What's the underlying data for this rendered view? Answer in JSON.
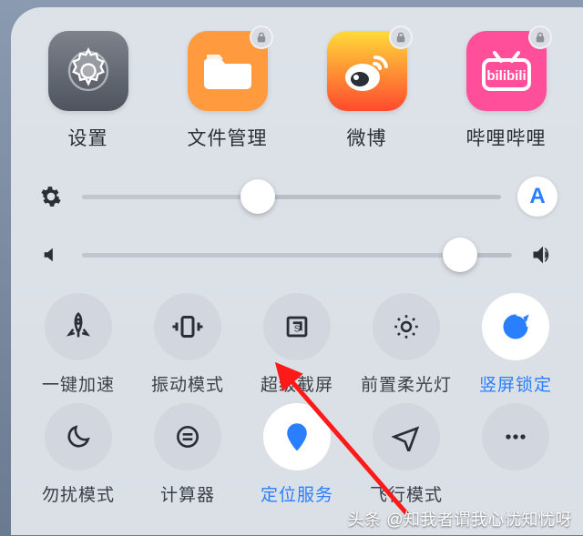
{
  "apps": [
    {
      "label": "设置",
      "locked": false
    },
    {
      "label": "文件管理",
      "locked": true
    },
    {
      "label": "微博",
      "locked": true
    },
    {
      "label": "哔哩哔哩",
      "locked": true
    }
  ],
  "sliders": {
    "brightness": {
      "value_percent": 42,
      "auto_label": "A"
    },
    "volume": {
      "value_percent": 88
    }
  },
  "toggles_row1": [
    {
      "key": "boost",
      "label": "一键加速",
      "active": false
    },
    {
      "key": "vibrate",
      "label": "振动模式",
      "active": false
    },
    {
      "key": "super",
      "label": "超级截屏",
      "active": false
    },
    {
      "key": "frontlight",
      "label": "前置柔光灯",
      "active": false
    },
    {
      "key": "rotation",
      "label": "竖屏锁定",
      "active": true
    }
  ],
  "toggles_row2": [
    {
      "key": "dnd",
      "label": "勿扰模式",
      "active": false
    },
    {
      "key": "calc",
      "label": "计算器",
      "active": false
    },
    {
      "key": "location",
      "label": "定位服务",
      "active": true
    },
    {
      "key": "airplane",
      "label": "飞行模式",
      "active": false
    },
    {
      "key": "more",
      "label": "",
      "active": false
    }
  ],
  "watermark": "头条 @知我者谓我心忧知忧呀",
  "colors": {
    "accent": "#2a7fff",
    "files_app": "#ff9b3e",
    "weibo_app": "#ff4a2e",
    "bilibili_app": "#ff4f9b"
  }
}
